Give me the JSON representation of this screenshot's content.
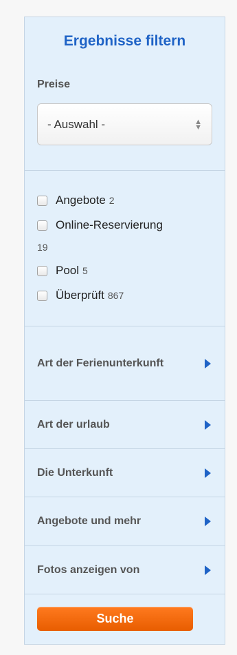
{
  "panel": {
    "title": "Ergebnisse filtern",
    "price": {
      "label": "Preise",
      "selected": "- Auswahl -"
    },
    "checkboxes": [
      {
        "label": "Angebote",
        "count": "2"
      },
      {
        "label": "Online-Reservierung",
        "count": "19"
      },
      {
        "label": "Pool",
        "count": "5"
      },
      {
        "label": "Überprüft",
        "count": "867"
      }
    ],
    "facets": [
      {
        "label": "Art der Ferienunterkunft"
      },
      {
        "label": "Art der urlaub"
      },
      {
        "label": "Die Unterkunft"
      },
      {
        "label": "Angebote und mehr"
      },
      {
        "label": "Fotos anzeigen von"
      }
    ],
    "search_label": "Suche"
  },
  "colors": {
    "panel_bg": "#e3f0fb",
    "title": "#1f63c6",
    "accent_orange": "#ef6a0a"
  },
  "icons": {
    "select": "up-down-chevrons-icon",
    "facet": "caret-right-icon"
  }
}
